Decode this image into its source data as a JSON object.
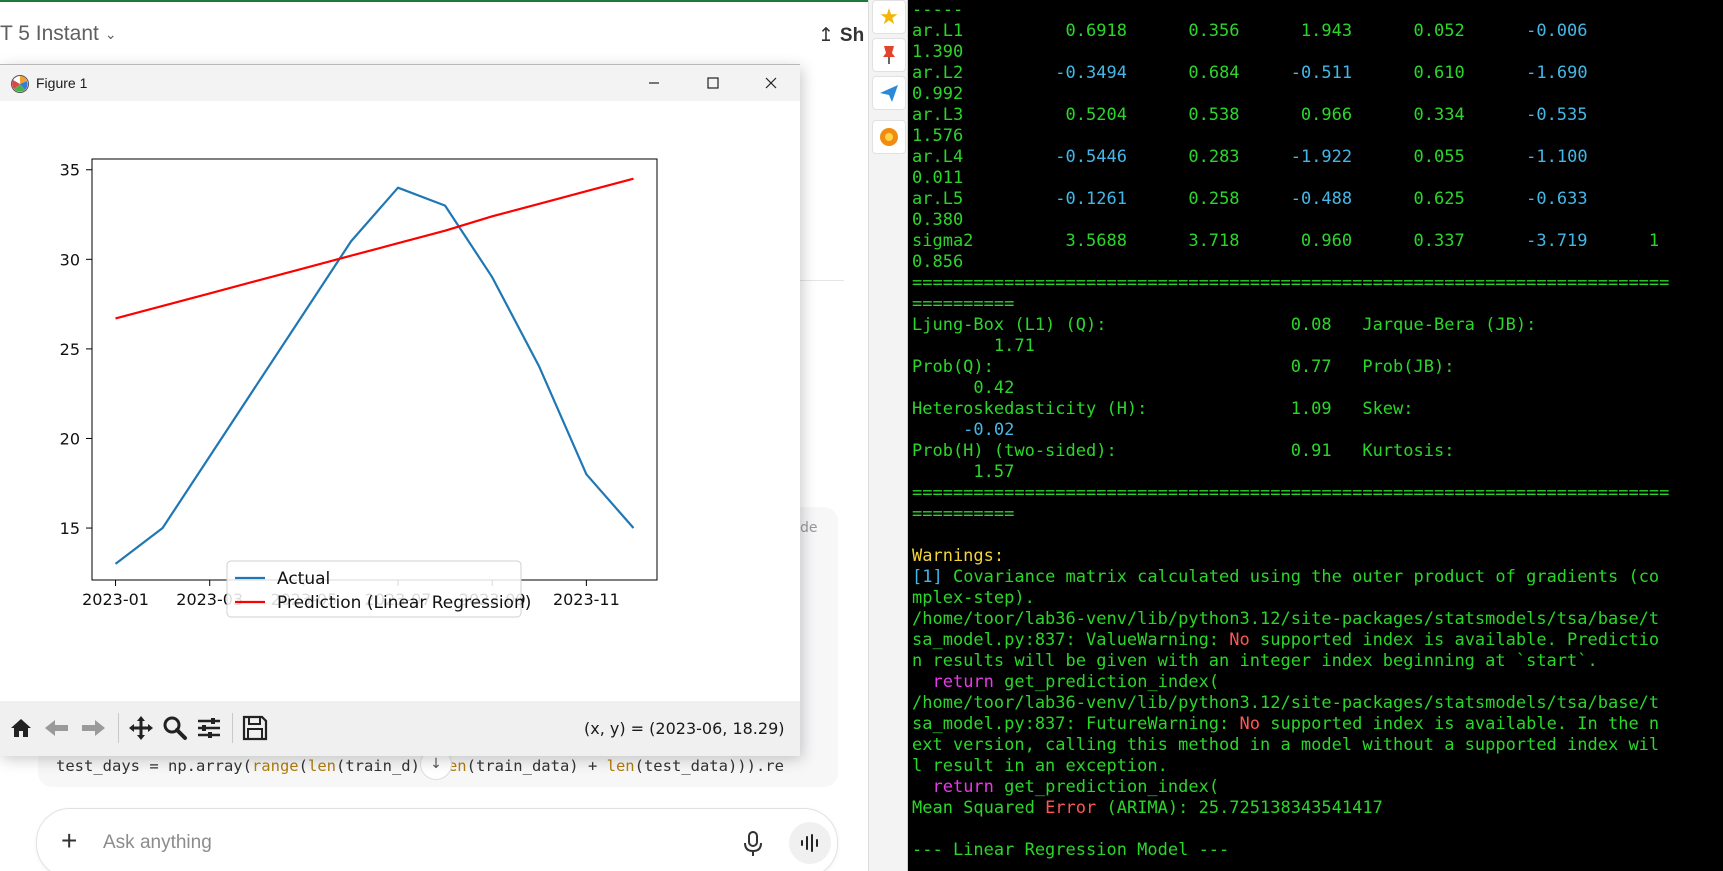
{
  "chat": {
    "model_title": "T 5 Instant",
    "share_label": "Sh",
    "code_fragment_right": "de",
    "code_line": {
      "prefix": "test_days = np.array(",
      "range": "range",
      "p1": "(",
      "len1": "len",
      "p2": "(train_d",
      "p3": "), ",
      "len2": "len",
      "p4": "(train_data) + ",
      "len3": "len",
      "p5": "(test_data))).re"
    },
    "ask_placeholder": "Ask anything"
  },
  "figure_window": {
    "title": "Figure 1",
    "coords_readout": "(x, y) = (2023-06, 18.29)"
  },
  "chart_data": {
    "type": "line",
    "x": [
      "2023-01",
      "2023-02",
      "2023-03",
      "2023-04",
      "2023-05",
      "2023-06",
      "2023-07",
      "2023-08",
      "2023-09",
      "2023-10",
      "2023-11",
      "2023-12"
    ],
    "x_tick_labels": [
      "2023-01",
      "2023-03",
      "2023-05",
      "2023-07",
      "2023-09",
      "2023-11"
    ],
    "y_ticks": [
      15,
      20,
      25,
      30,
      35
    ],
    "ylim": [
      12.1,
      35.6
    ],
    "series": [
      {
        "name": "Actual",
        "color": "#1f77b4",
        "values": [
          13,
          15,
          19,
          23,
          27,
          31,
          34,
          33,
          29,
          24,
          18,
          15
        ]
      },
      {
        "name": "Prediction (Linear Regression)",
        "color": "#ff0000",
        "values": [
          26.7,
          27.4,
          28.1,
          28.8,
          29.5,
          30.2,
          30.9,
          31.6,
          32.4,
          33.1,
          33.8,
          34.5
        ]
      }
    ],
    "legend_position": "lower-center",
    "grid": false
  },
  "terminal": {
    "lines": [
      [
        {
          "t": "-----",
          "c": "green"
        }
      ],
      [
        {
          "t": "ar.L1          0.6918      0.356      1.943      0.052      ",
          "c": "green"
        },
        {
          "t": "-0.006",
          "c": "cyan"
        }
      ],
      [
        {
          "t": "1.390",
          "c": "green"
        }
      ],
      [
        {
          "t": "ar.L2         ",
          "c": "green"
        },
        {
          "t": "-0.3494",
          "c": "cyan"
        },
        {
          "t": "      0.684     ",
          "c": "green"
        },
        {
          "t": "-0.511",
          "c": "cyan"
        },
        {
          "t": "      0.610      ",
          "c": "green"
        },
        {
          "t": "-1.690",
          "c": "cyan"
        }
      ],
      [
        {
          "t": "0.992",
          "c": "green"
        }
      ],
      [
        {
          "t": "ar.L3          0.5204      0.538      0.966      0.334      ",
          "c": "green"
        },
        {
          "t": "-0.535",
          "c": "cyan"
        }
      ],
      [
        {
          "t": "1.576",
          "c": "green"
        }
      ],
      [
        {
          "t": "ar.L4         ",
          "c": "green"
        },
        {
          "t": "-0.5446",
          "c": "cyan"
        },
        {
          "t": "      0.283     ",
          "c": "green"
        },
        {
          "t": "-1.922",
          "c": "cyan"
        },
        {
          "t": "      0.055      ",
          "c": "green"
        },
        {
          "t": "-1.100",
          "c": "cyan"
        }
      ],
      [
        {
          "t": "0.011",
          "c": "green"
        }
      ],
      [
        {
          "t": "ar.L5         ",
          "c": "green"
        },
        {
          "t": "-0.1261",
          "c": "cyan"
        },
        {
          "t": "      0.258     ",
          "c": "green"
        },
        {
          "t": "-0.488",
          "c": "cyan"
        },
        {
          "t": "      0.625      ",
          "c": "green"
        },
        {
          "t": "-0.633",
          "c": "cyan"
        }
      ],
      [
        {
          "t": "0.380",
          "c": "green"
        }
      ],
      [
        {
          "t": "sigma2         3.5688      3.718      0.960      0.337      ",
          "c": "green"
        },
        {
          "t": "-3.719",
          "c": "cyan"
        },
        {
          "t": "      1",
          "c": "green"
        }
      ],
      [
        {
          "t": "0.856",
          "c": "green"
        }
      ],
      [
        {
          "t": "==========================================================================",
          "c": "green"
        }
      ],
      [
        {
          "t": "==========",
          "c": "green"
        }
      ],
      [
        {
          "t": "Ljung-Box (L1) (Q):                  0.08   Jarque-Bera (JB):",
          "c": "green"
        }
      ],
      [
        {
          "t": "        1.71",
          "c": "green"
        }
      ],
      [
        {
          "t": "Prob(Q):                             0.77   Prob(JB):",
          "c": "green"
        }
      ],
      [
        {
          "t": "      0.42",
          "c": "green"
        }
      ],
      [
        {
          "t": "Heteroskedasticity (H):              1.09   Skew:",
          "c": "green"
        }
      ],
      [
        {
          "t": "     -0.02",
          "c": "cyan"
        }
      ],
      [
        {
          "t": "Prob(H) (two-sided):                 0.91   Kurtosis:",
          "c": "green"
        }
      ],
      [
        {
          "t": "      1.57",
          "c": "green"
        }
      ],
      [
        {
          "t": "==========================================================================",
          "c": "green"
        }
      ],
      [
        {
          "t": "==========",
          "c": "green"
        }
      ],
      [
        {
          "t": "",
          "c": "green"
        }
      ],
      [
        {
          "t": "Warnings:",
          "c": "yellow"
        }
      ],
      [
        {
          "t": "[1]",
          "c": "cyan"
        },
        {
          "t": " Covariance matrix calculated using the outer product of gradients (co",
          "c": "green"
        }
      ],
      [
        {
          "t": "mplex-step).",
          "c": "green"
        }
      ],
      [
        {
          "t": "/home/toor/lab36-venv/lib/python3.12/site-packages/statsmodels/tsa/base/t",
          "c": "green"
        }
      ],
      [
        {
          "t": "sa_model.py:837: ValueWarning: ",
          "c": "green"
        },
        {
          "t": "No",
          "c": "red"
        },
        {
          "t": " supported index is available. Predictio",
          "c": "green"
        }
      ],
      [
        {
          "t": "n results will be given with an integer index beginning at `start`.",
          "c": "green"
        }
      ],
      [
        {
          "t": "  ",
          "c": "green"
        },
        {
          "t": "return",
          "c": "magenta"
        },
        {
          "t": " get_prediction_index(",
          "c": "green"
        }
      ],
      [
        {
          "t": "/home/toor/lab36-venv/lib/python3.12/site-packages/statsmodels/tsa/base/t",
          "c": "green"
        }
      ],
      [
        {
          "t": "sa_model.py:837: FutureWarning: ",
          "c": "green"
        },
        {
          "t": "No",
          "c": "red"
        },
        {
          "t": " supported index is available. In the n",
          "c": "green"
        }
      ],
      [
        {
          "t": "ext version, calling this method in a model without a supported index wil",
          "c": "green"
        }
      ],
      [
        {
          "t": "l result in an exception.",
          "c": "green"
        }
      ],
      [
        {
          "t": "  ",
          "c": "green"
        },
        {
          "t": "return",
          "c": "magenta"
        },
        {
          "t": " get_prediction_index(",
          "c": "green"
        }
      ],
      [
        {
          "t": "Mean Squared ",
          "c": "green"
        },
        {
          "t": "Error",
          "c": "red"
        },
        {
          "t": " (ARIMA): 25.725138343541417",
          "c": "green"
        }
      ],
      [
        {
          "t": "",
          "c": "green"
        }
      ],
      [
        {
          "t": "--- Linear Regression Model ---",
          "c": "green"
        }
      ]
    ]
  },
  "icons": [
    "star-icon",
    "pin-icon",
    "send-icon",
    "sun-icon",
    "home-icon",
    "back-icon",
    "forward-icon",
    "pan-icon",
    "zoom-icon",
    "configure-icon",
    "save-icon",
    "minimize-icon",
    "maximize-icon",
    "close-icon",
    "mic-icon",
    "voice-icon",
    "share-icon",
    "plus-icon"
  ]
}
